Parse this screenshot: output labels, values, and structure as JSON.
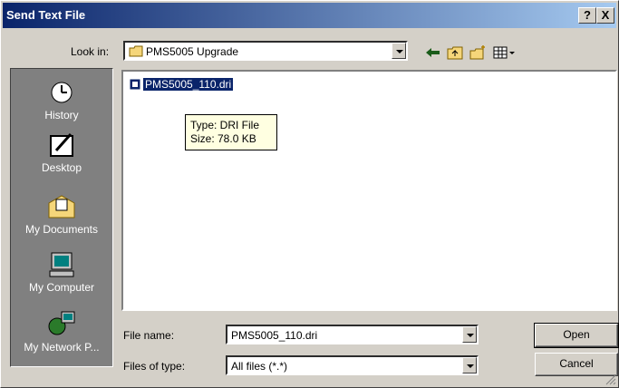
{
  "window": {
    "title": "Send Text File",
    "help_label": "?",
    "close_label": "X"
  },
  "look_in": {
    "label": "Look in:",
    "value": "PMS5005 Upgrade"
  },
  "places": [
    {
      "label": "History",
      "icon": "history-icon"
    },
    {
      "label": "Desktop",
      "icon": "desktop-icon"
    },
    {
      "label": "My Documents",
      "icon": "my-documents-icon"
    },
    {
      "label": "My Computer",
      "icon": "my-computer-icon"
    },
    {
      "label": "My Network P...",
      "icon": "my-network-places-icon"
    }
  ],
  "files": [
    {
      "name": "PMS5005_110.dri",
      "selected": true
    }
  ],
  "tooltip": {
    "line1": "Type: DRI File",
    "line2": "Size: 78.0 KB"
  },
  "file_name": {
    "label": "File name:",
    "value": "PMS5005_110.dri"
  },
  "file_type": {
    "label": "Files of type:",
    "value": "All files (*.*)"
  },
  "buttons": {
    "open": "Open",
    "cancel": "Cancel"
  },
  "colors": {
    "titlebar_start": "#0a246a",
    "titlebar_end": "#a6caf0",
    "dialog_bg": "#d4d0c8",
    "places_bg": "#808080"
  }
}
